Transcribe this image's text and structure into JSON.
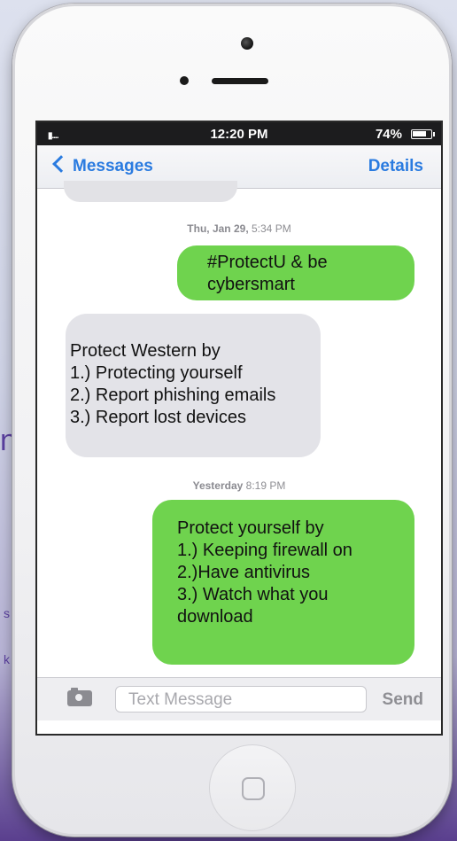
{
  "background": {
    "side_letter": "n",
    "side_text_1": "s",
    "side_text_2": "k"
  },
  "status_bar": {
    "signal": "▮....",
    "time": "12:20 PM",
    "battery": "74%"
  },
  "nav": {
    "back_label": "Messages",
    "details_label": "Details"
  },
  "conversation": [
    {
      "type": "timestamp",
      "day": "Thu, Jan 29,",
      "time": "5:34 PM"
    },
    {
      "type": "outgoing",
      "lines": [
        "#ProtectU & be",
        "cybersmart"
      ]
    },
    {
      "type": "incoming",
      "lines": [
        "Protect Western by",
        "1.) Protecting yourself",
        "2.) Report phishing emails",
        "3.) Report lost devices"
      ]
    },
    {
      "type": "timestamp",
      "day": "Yesterday",
      "time": "8:19 PM"
    },
    {
      "type": "outgoing",
      "lines": [
        "Protect yourself by",
        "1.) Keeping firewall on",
        "2.)Have antivirus",
        "3.) Watch what you",
        "download"
      ]
    }
  ],
  "composer": {
    "placeholder": "Text Message",
    "send_label": "Send"
  },
  "colors": {
    "outgoing_bubble": "#6fd34e",
    "incoming_bubble": "#e3e3e8",
    "accent": "#2a7be0"
  }
}
